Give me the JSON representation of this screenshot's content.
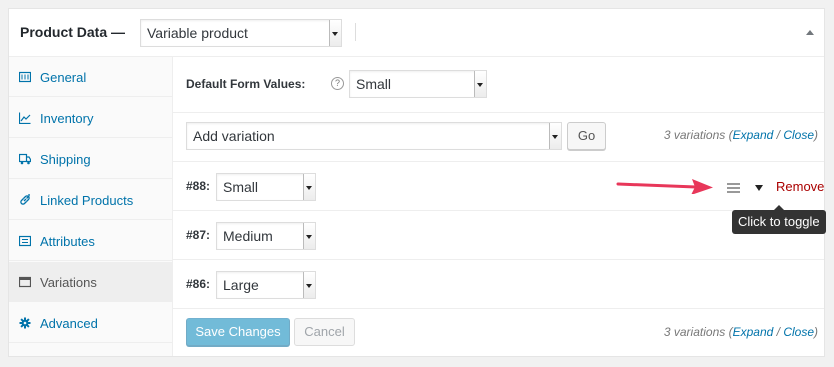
{
  "header": {
    "title": "Product Data —",
    "product_type": "Variable product"
  },
  "tabs": [
    {
      "label": "General",
      "icon": "general-icon"
    },
    {
      "label": "Inventory",
      "icon": "inventory-icon"
    },
    {
      "label": "Shipping",
      "icon": "truck-icon"
    },
    {
      "label": "Linked Products",
      "icon": "link-icon"
    },
    {
      "label": "Attributes",
      "icon": "attributes-icon"
    },
    {
      "label": "Variations",
      "icon": "variations-icon",
      "active": true
    },
    {
      "label": "Advanced",
      "icon": "gear-icon"
    }
  ],
  "defaults": {
    "label": "Default Form Values:",
    "help": "?",
    "value": "Small"
  },
  "toolbar": {
    "action": "Add variation",
    "go": "Go",
    "count_text": "3 variations",
    "open_paren": "(",
    "expand": "Expand",
    "slash": " / ",
    "close": "Close",
    "close_paren": ")"
  },
  "variations": [
    {
      "id": "#88:",
      "value": "Small"
    },
    {
      "id": "#87:",
      "value": "Medium"
    },
    {
      "id": "#86:",
      "value": "Large"
    }
  ],
  "row_actions": {
    "remove": "Remove",
    "tooltip": "Click to toggle"
  },
  "footer": {
    "save": "Save Changes",
    "cancel": "Cancel"
  },
  "colors": {
    "link": "#0073aa",
    "remove": "#aa0000",
    "arrow": "#e8375a"
  }
}
